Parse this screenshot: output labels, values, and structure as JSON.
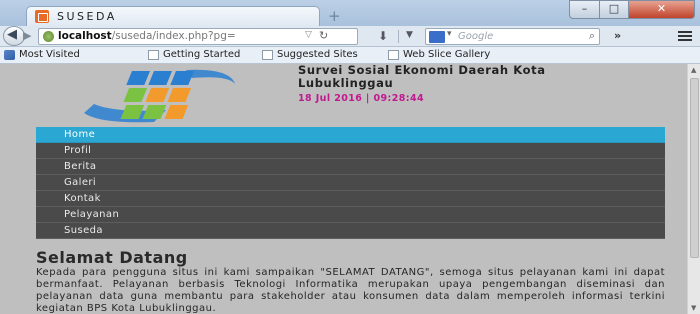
{
  "browser": {
    "tab_title": "SUSEDA",
    "new_tab": "+",
    "url_host": "localhost",
    "url_path": "/suseda/index.php?pg=",
    "search_placeholder": "Google",
    "window_buttons": {
      "minimize": "–",
      "maximize": "□",
      "close": "✕"
    },
    "bookmarks": [
      "Most Visited",
      "Getting Started",
      "Suggested Sites",
      "Web Slice Gallery"
    ]
  },
  "site": {
    "title": "Survei Sosial Ekonomi Daerah Kota Lubuklinggau",
    "datetime": "18 Jul 2016 | 09:28:44",
    "logo_colors": [
      "#2a7fd0",
      "#7cc242",
      "#f29b2c"
    ]
  },
  "menu": {
    "items": [
      {
        "label": "Home",
        "active": true
      },
      {
        "label": "Profil",
        "active": false
      },
      {
        "label": "Berita",
        "active": false
      },
      {
        "label": "Galeri",
        "active": false
      },
      {
        "label": "Kontak",
        "active": false
      },
      {
        "label": "Pelayanan",
        "active": false
      },
      {
        "label": "Suseda",
        "active": false
      }
    ],
    "active_color": "#2ba7d3",
    "item_color": "#4a4a4a"
  },
  "content": {
    "heading": "Selamat Datang",
    "body": "Kepada para pengguna situs ini kami sampaikan \"SELAMAT DATANG\", semoga situs pelayanan kami ini dapat bermanfaat. Pelayanan berbasis Teknologi Informatika merupakan upaya pengembangan diseminasi dan pelayanan data guna membantu para stakeholder atau konsumen data dalam memperoleh informasi terkini kegiatan BPS Kota Lubuklinggau."
  }
}
